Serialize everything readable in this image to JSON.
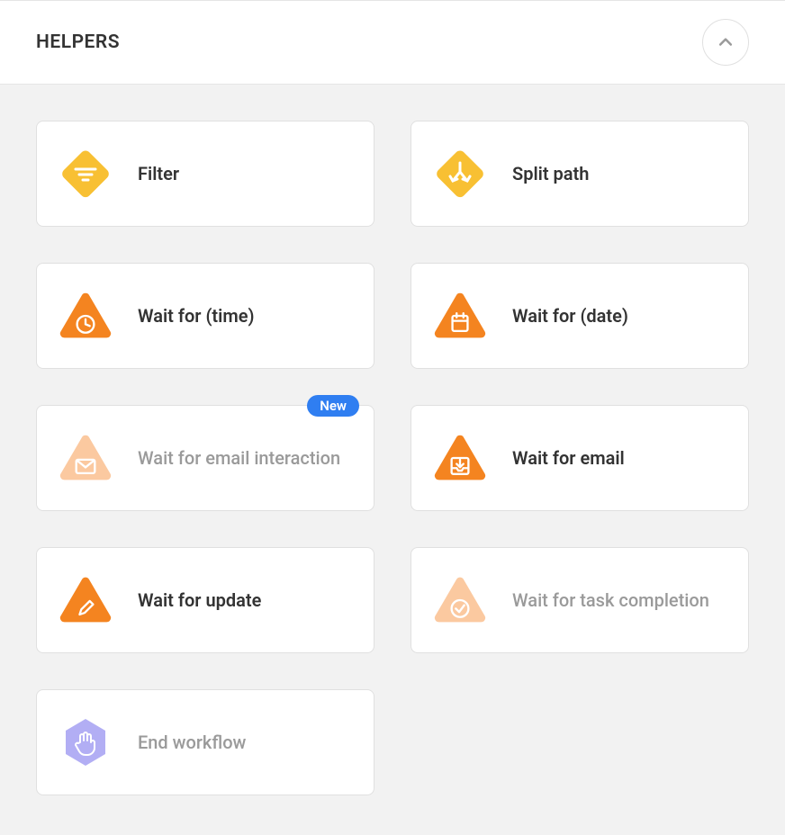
{
  "section": {
    "title": "HELPERS"
  },
  "cards": [
    {
      "label": "Filter"
    },
    {
      "label": "Split path"
    },
    {
      "label": "Wait for (time)"
    },
    {
      "label": "Wait for (date)"
    },
    {
      "label": "Wait for email interaction",
      "badge": "New"
    },
    {
      "label": "Wait for email"
    },
    {
      "label": "Wait for update"
    },
    {
      "label": "Wait for task completion"
    },
    {
      "label": "End workflow"
    }
  ],
  "colors": {
    "orange": "#f48420",
    "orange_light": "#fbc9a0",
    "yellow": "#f8c033",
    "purple_light": "#b2aef4",
    "blue": "#2f7ef1"
  }
}
